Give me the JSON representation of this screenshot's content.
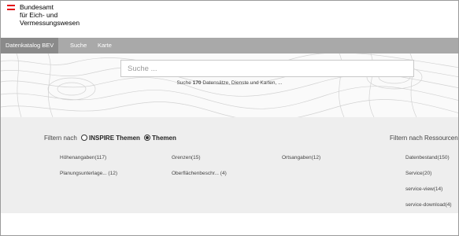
{
  "logo": {
    "lines": [
      "Bundesamt",
      "für Eich- und",
      "Vermessungswesen"
    ],
    "flag_colors": [
      "#e30613",
      "#ffffff",
      "#e30613"
    ]
  },
  "nav": {
    "items": [
      {
        "label": "Datenkatalog BEV",
        "active": true
      },
      {
        "label": "Suche",
        "active": false
      },
      {
        "label": "Karte",
        "active": false
      }
    ]
  },
  "search": {
    "placeholder": "Suche ...",
    "count_prefix": "Suche",
    "count_value": "170",
    "count_suffix": "Datensätze, Dienste und Karten, ..."
  },
  "filters": {
    "left_prefix": "Filtern nach",
    "option_inspire": "INSPIRE Themen",
    "option_themen": "Themen",
    "selected": "Themen",
    "themen_items": [
      "Höhenangaben(117)",
      "Grenzen(15)",
      "Ortsangaben(12)",
      "Planungsunterlage... (12)",
      "Oberflächenbeschr... (4)"
    ],
    "right_title": "Filtern nach Ressourcen",
    "ressourcen_items": [
      "Datenbestand(150)",
      "Service(20)",
      "service-view(14)",
      "service-download(4)"
    ]
  },
  "colors": {
    "nav_bg": "#a9a9a9",
    "nav_active": "#8a8a8a",
    "filter_bg": "#eeeeee"
  }
}
